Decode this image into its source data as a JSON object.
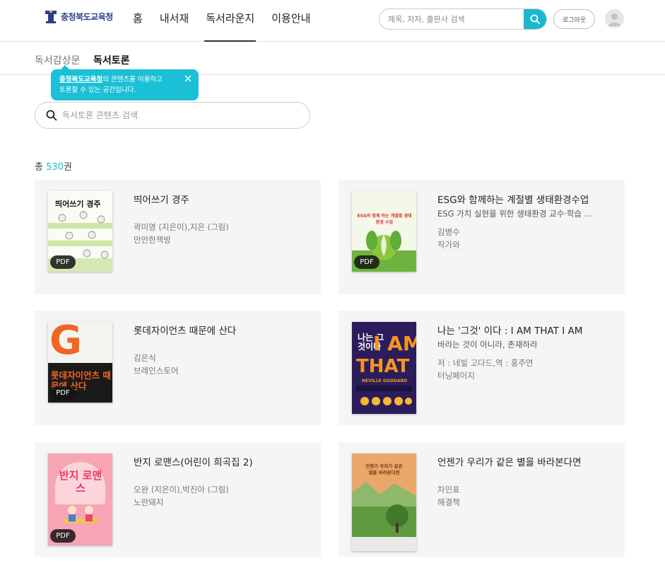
{
  "header": {
    "logo_text": "충청북도교육청",
    "nav": [
      {
        "label": "홈"
      },
      {
        "label": "내서재"
      },
      {
        "label": "독서라운지"
      },
      {
        "label": "이용안내"
      }
    ],
    "search_placeholder": "제목, 저자, 출판사 검색",
    "logout_label": "로그아웃"
  },
  "subnav": {
    "items": [
      {
        "label": "독서감상문"
      },
      {
        "label": "독서토론"
      }
    ]
  },
  "tooltip": {
    "org": "충청북도교육청",
    "line1_rest": "의 콘텐츠를 이용하고",
    "line2": "토론할 수 있는 공간입니다."
  },
  "content_search": {
    "placeholder": "독서토론 콘텐츠 검색"
  },
  "total": {
    "prefix": "총 ",
    "count": "530",
    "suffix": "권"
  },
  "books": [
    {
      "title": "띄어쓰기 경주",
      "subtitle": "",
      "author": "곽미영 (지은이),지은 (그림)",
      "publisher": "만만한책방",
      "badge": "PDF",
      "cover_text": "띄어쓰기 경주"
    },
    {
      "title": "ESG와 함께하는 계절별 생태환경수업",
      "subtitle": "ESG 가치 실현을 위한 생태환경 교수·학습 ...",
      "author": "김병수",
      "publisher": "작가와",
      "badge": "PDF",
      "cover_text": "ESG와 함께 하는 계절별 생태환경 수업"
    },
    {
      "title": "롯데자이언츠 때문에 산다",
      "subtitle": "",
      "author": "김은식",
      "publisher": "브레인스토어",
      "badge": "PDF",
      "cover_text": "롯데자이언츠 때문에 산다",
      "cover_letter": "G"
    },
    {
      "title": "나는 '그것' 이다 : I AM THAT I AM",
      "subtitle": "바라는 것이 아니라, 존재하라",
      "author": "저 : 네빌 고다드,역 : 홍주연",
      "publisher": "터닝페이지",
      "badge": "",
      "cover_text": "나는 그것이다",
      "cover_en1": "I AM",
      "cover_en2": "THAT",
      "cover_en3": "NEVILLE GODDARD"
    },
    {
      "title": "반지 로맨스(어린이 희곡집 2)",
      "subtitle": "",
      "author": "오완 (지은이),박진아 (그림)",
      "publisher": "노란돼지",
      "badge": "PDF",
      "cover_text": "반지 로맨스"
    },
    {
      "title": "언젠가 우리가 같은 별을 바라본다면",
      "subtitle": "",
      "author": "차인표",
      "publisher": "해결책",
      "badge": "",
      "cover_text": "언젠가 우리가 같은 별을 바라본다면"
    }
  ],
  "colors": {
    "accent": "#1bb7cf",
    "card_bg": "#f5f5f5"
  }
}
